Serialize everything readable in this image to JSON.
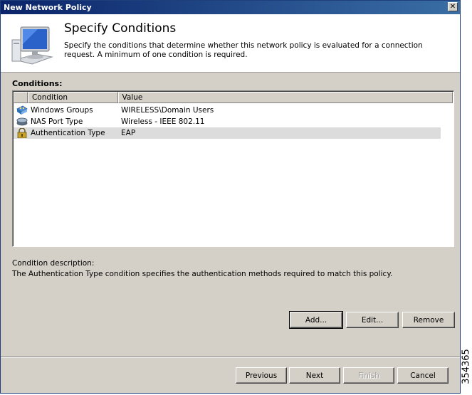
{
  "window": {
    "title": "New Network Policy"
  },
  "header": {
    "title": "Specify Conditions",
    "description": "Specify the conditions that determine whether this network policy is evaluated for a connection request. A minimum of one condition is required."
  },
  "conditions": {
    "label": "Conditions:",
    "columns": [
      "Condition",
      "Value"
    ],
    "rows": [
      {
        "icon": "users-group-icon",
        "condition": "Windows Groups",
        "value": "WIRELESS\\Domain Users"
      },
      {
        "icon": "network-port-icon",
        "condition": "NAS Port Type",
        "value": "Wireless - IEEE 802.11"
      },
      {
        "icon": "padlock-icon",
        "condition": "Authentication Type",
        "value": "EAP",
        "selected": true
      }
    ]
  },
  "description": {
    "label": "Condition description:",
    "text": "The Authentication Type condition specifies the authentication methods required to match this policy."
  },
  "actions": {
    "add": "Add...",
    "edit": "Edit...",
    "remove": "Remove"
  },
  "wizard": {
    "previous": "Previous",
    "next": "Next",
    "finish": "Finish",
    "cancel": "Cancel"
  },
  "figure_id": "354365"
}
